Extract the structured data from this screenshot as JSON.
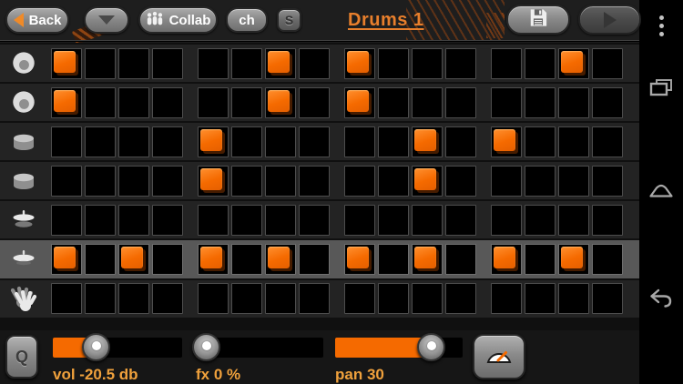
{
  "header": {
    "back": "Back",
    "collab": "Collab",
    "channel": "ch",
    "solo": "S",
    "title": "Drums 1",
    "icons": [
      "chevron-left-icon",
      "chevron-down-icon",
      "people-icon",
      "floppy-disk-icon",
      "play-icon"
    ]
  },
  "tracks": [
    {
      "id": "kick-1",
      "icon": "kick-drum-icon",
      "selected": false,
      "steps": [
        1,
        0,
        0,
        0,
        0,
        0,
        1,
        0,
        1,
        0,
        0,
        0,
        0,
        0,
        1,
        0
      ]
    },
    {
      "id": "kick-2",
      "icon": "kick-drum-icon",
      "selected": false,
      "steps": [
        1,
        0,
        0,
        0,
        0,
        0,
        1,
        0,
        1,
        0,
        0,
        0,
        0,
        0,
        0,
        0
      ]
    },
    {
      "id": "tom-1",
      "icon": "tom-drum-icon",
      "selected": false,
      "steps": [
        0,
        0,
        0,
        0,
        1,
        0,
        0,
        0,
        0,
        0,
        1,
        0,
        1,
        0,
        0,
        0
      ]
    },
    {
      "id": "tom-2",
      "icon": "tom-drum-icon",
      "selected": false,
      "steps": [
        0,
        0,
        0,
        0,
        1,
        0,
        0,
        0,
        0,
        0,
        1,
        0,
        0,
        0,
        0,
        0
      ]
    },
    {
      "id": "hihat",
      "icon": "hihat-icon",
      "selected": false,
      "steps": [
        0,
        0,
        0,
        0,
        0,
        0,
        0,
        0,
        0,
        0,
        0,
        0,
        0,
        0,
        0,
        0
      ]
    },
    {
      "id": "cymbal",
      "icon": "cymbal-icon",
      "selected": true,
      "steps": [
        1,
        0,
        1,
        0,
        1,
        0,
        1,
        0,
        1,
        0,
        1,
        0,
        1,
        0,
        1,
        0
      ]
    },
    {
      "id": "clap",
      "icon": "clap-icon",
      "selected": false,
      "steps": [
        0,
        0,
        0,
        0,
        0,
        0,
        0,
        0,
        0,
        0,
        0,
        0,
        0,
        0,
        0,
        0
      ]
    }
  ],
  "controls": {
    "quantize": "Q",
    "metronome_icon": "gauge-icon",
    "sliders": [
      {
        "id": "volume",
        "label": "vol -20.5 db",
        "fill_pct": 33
      },
      {
        "id": "fx",
        "label": "fx 0 %",
        "fill_pct": 6
      },
      {
        "id": "pan",
        "label": "pan 30",
        "fill_pct": 75
      }
    ]
  },
  "android_nav": {
    "icons": [
      "menu-dots-icon",
      "recent-apps-icon",
      "home-icon",
      "back-arrow-icon"
    ]
  },
  "colors": {
    "accent": "#f56a00",
    "pad_orange": "#f56e00",
    "label_orange": "#f0a13c",
    "title_orange": "#e87f2c"
  }
}
